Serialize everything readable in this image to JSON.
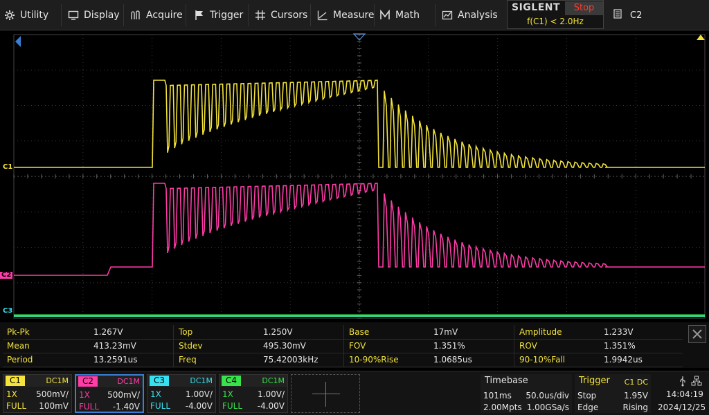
{
  "menu": [
    {
      "label": "Utility",
      "icon": "gear-icon"
    },
    {
      "label": "Display",
      "icon": "display-icon"
    },
    {
      "label": "Acquire",
      "icon": "acquire-icon"
    },
    {
      "label": "Trigger",
      "icon": "flag-icon"
    },
    {
      "label": "Cursors",
      "icon": "cursors-icon"
    },
    {
      "label": "Measure",
      "icon": "measure-icon"
    },
    {
      "label": "Math",
      "icon": "math-icon"
    },
    {
      "label": "Analysis",
      "icon": "analysis-icon"
    }
  ],
  "brand": {
    "name": "SIGLENT",
    "run_state": "Stop",
    "filter": "f(C1) < 2.0Hz"
  },
  "active_channel": "C2",
  "colors": {
    "c1": "#f3e33a",
    "c2": "#ff3ca8",
    "c3": "#35e0f0",
    "c4": "#37e24a",
    "grid": "#3a3a3a"
  },
  "channel_markers": {
    "c1": "C1",
    "c2": "C2",
    "c3": "C3"
  },
  "measurements": [
    [
      {
        "label": "Pk-Pk",
        "value": "1.267V"
      },
      {
        "label": "Top",
        "value": "1.250V"
      },
      {
        "label": "Base",
        "value": "17mV"
      },
      {
        "label": "Amplitude",
        "value": "1.233V"
      }
    ],
    [
      {
        "label": "Mean",
        "value": "413.23mV"
      },
      {
        "label": "Stdev",
        "value": "495.30mV"
      },
      {
        "label": "FOV",
        "value": "1.351%"
      },
      {
        "label": "ROV",
        "value": "1.351%"
      }
    ],
    [
      {
        "label": "Period",
        "value": "13.2591us"
      },
      {
        "label": "Freq",
        "value": "75.42003kHz"
      },
      {
        "label": "10-90%Rise",
        "value": "1.0685us"
      },
      {
        "label": "90-10%Fall",
        "value": "1.9942us"
      }
    ]
  ],
  "channels": [
    {
      "tag": "C1",
      "coupling": "DC1M",
      "probe": "1X",
      "scale": "500mV/",
      "bw": "FULL",
      "offset": "100mV"
    },
    {
      "tag": "C2",
      "coupling": "DC1M",
      "probe": "1X",
      "scale": "500mV/",
      "bw": "FULL",
      "offset": "-1.40V"
    },
    {
      "tag": "C3",
      "coupling": "DC1M",
      "probe": "1X",
      "scale": "1.00V/",
      "bw": "FULL",
      "offset": "-4.00V"
    },
    {
      "tag": "C4",
      "coupling": "DC1M",
      "probe": "1X",
      "scale": "1.00V/",
      "bw": "FULL",
      "offset": "-4.00V"
    }
  ],
  "timebase": {
    "title": "Timebase",
    "delay": "101ms",
    "scale": "50.0us/div",
    "memory": "2.00Mpts",
    "rate": "1.00GSa/s"
  },
  "trigger": {
    "title": "Trigger",
    "source": "C1 DC",
    "mode": "Stop",
    "level": "1.95V",
    "type": "Edge",
    "slope": "Rising"
  },
  "clock": {
    "time": "14:04:19",
    "date": "2024/12/25"
  }
}
